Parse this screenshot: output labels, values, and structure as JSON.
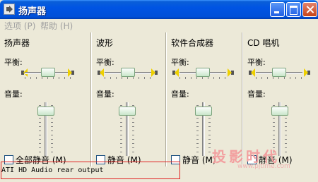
{
  "window": {
    "title": "扬声器"
  },
  "menu": {
    "options": "选项 (P)",
    "help": "帮助 (H)"
  },
  "channels": [
    {
      "title": "扬声器",
      "balance_label": "平衡:",
      "volume_label": "音量:",
      "mute_label": "全部静音 (M)",
      "balance": 0.5,
      "volume": 0.9
    },
    {
      "title": "波形",
      "balance_label": "平衡:",
      "volume_label": "音量:",
      "mute_label": "静音 (M)",
      "balance": 0.5,
      "volume": 0.9
    },
    {
      "title": "软件合成器",
      "balance_label": "平衡:",
      "volume_label": "音量:",
      "mute_label": "静音 (M)",
      "balance": 0.5,
      "volume": 0.9
    },
    {
      "title": "CD 唱机",
      "balance_label": "平衡:",
      "volume_label": "音量:",
      "mute_label": "静音 (M)",
      "balance": 0.5,
      "volume": 0.9
    }
  ],
  "status": "ATI HD Audio rear output",
  "watermark": {
    "text": "投影时代",
    "url": "www.pjtime.com"
  },
  "colors": {
    "titlebar": "#0054e3",
    "highlight": "#e02020",
    "face": "#ece9d8"
  }
}
